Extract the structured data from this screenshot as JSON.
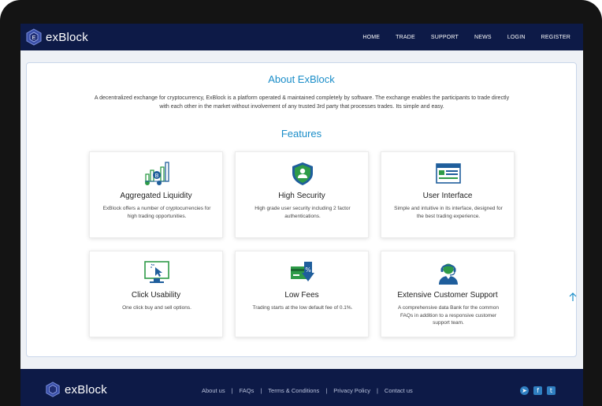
{
  "brand": {
    "name": "exBlock"
  },
  "nav": {
    "items": [
      {
        "label": "HOME"
      },
      {
        "label": "TRADE"
      },
      {
        "label": "SUPPORT"
      },
      {
        "label": "NEWS"
      },
      {
        "label": "LOGIN"
      },
      {
        "label": "REGISTER"
      }
    ]
  },
  "about": {
    "title": "About ExBlock",
    "text": "A decentralized exchange for cryptocurrency, ExBlock is a platform operated & maintained completely by software. The exchange enables the participants to trade directly with each other in the market without involvement of any trusted 3rd party that processes trades. Its simple and easy."
  },
  "features": {
    "title": "Features",
    "items": [
      {
        "title": "Aggregated Liquidity",
        "description": "ExBlock offers a number of cryptocurrencies for high trading opportunities.",
        "icon": "liquidity-chart-icon"
      },
      {
        "title": "High Security",
        "description": "High grade user security including 2 factor authentications.",
        "icon": "shield-user-icon"
      },
      {
        "title": "User Interface",
        "description": "Simple and intuitive in its interface, designed for the best trading experience.",
        "icon": "browser-window-icon"
      },
      {
        "title": "Click Usability",
        "description": "One click buy and sell options.",
        "icon": "monitor-click-icon"
      },
      {
        "title": "Low Fees",
        "description": "Trading starts at the low default fee of 0.1%.",
        "icon": "card-percent-icon"
      },
      {
        "title": "Extensive Customer Support",
        "description": "A comprehensive data Bank for the common FAQs in addition to a responsive customer support team.",
        "icon": "headset-agent-icon"
      }
    ]
  },
  "footer": {
    "brand_name": "exBlock",
    "links": [
      {
        "label": "About us"
      },
      {
        "label": "FAQs"
      },
      {
        "label": "Terms & Conditions"
      },
      {
        "label": "Privacy Policy"
      },
      {
        "label": "Contact us"
      }
    ],
    "social": [
      {
        "name": "telegram-icon",
        "glyph": "➤"
      },
      {
        "name": "facebook-icon",
        "glyph": "f"
      },
      {
        "name": "twitter-icon",
        "glyph": "t"
      }
    ]
  },
  "colors": {
    "navbar": "#0d1a47",
    "accent": "#1a8dc8",
    "icon_green": "#2e9b48",
    "icon_blue": "#1f5e9c"
  }
}
